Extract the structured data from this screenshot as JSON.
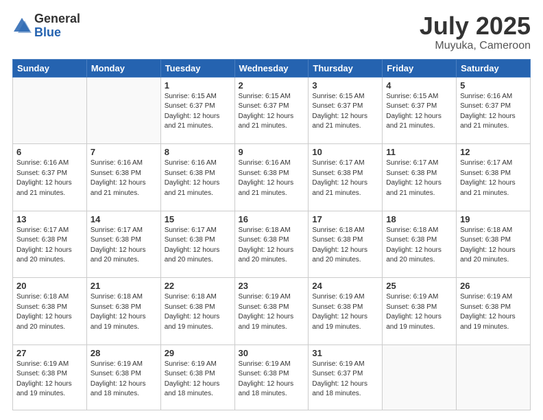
{
  "logo": {
    "general": "General",
    "blue": "Blue"
  },
  "header": {
    "title": "July 2025",
    "subtitle": "Muyuka, Cameroon"
  },
  "weekdays": [
    "Sunday",
    "Monday",
    "Tuesday",
    "Wednesday",
    "Thursday",
    "Friday",
    "Saturday"
  ],
  "weeks": [
    [
      {
        "day": null,
        "info": null
      },
      {
        "day": null,
        "info": null
      },
      {
        "day": "1",
        "info": "Sunrise: 6:15 AM\nSunset: 6:37 PM\nDaylight: 12 hours and 21 minutes."
      },
      {
        "day": "2",
        "info": "Sunrise: 6:15 AM\nSunset: 6:37 PM\nDaylight: 12 hours and 21 minutes."
      },
      {
        "day": "3",
        "info": "Sunrise: 6:15 AM\nSunset: 6:37 PM\nDaylight: 12 hours and 21 minutes."
      },
      {
        "day": "4",
        "info": "Sunrise: 6:15 AM\nSunset: 6:37 PM\nDaylight: 12 hours and 21 minutes."
      },
      {
        "day": "5",
        "info": "Sunrise: 6:16 AM\nSunset: 6:37 PM\nDaylight: 12 hours and 21 minutes."
      }
    ],
    [
      {
        "day": "6",
        "info": "Sunrise: 6:16 AM\nSunset: 6:37 PM\nDaylight: 12 hours and 21 minutes."
      },
      {
        "day": "7",
        "info": "Sunrise: 6:16 AM\nSunset: 6:38 PM\nDaylight: 12 hours and 21 minutes."
      },
      {
        "day": "8",
        "info": "Sunrise: 6:16 AM\nSunset: 6:38 PM\nDaylight: 12 hours and 21 minutes."
      },
      {
        "day": "9",
        "info": "Sunrise: 6:16 AM\nSunset: 6:38 PM\nDaylight: 12 hours and 21 minutes."
      },
      {
        "day": "10",
        "info": "Sunrise: 6:17 AM\nSunset: 6:38 PM\nDaylight: 12 hours and 21 minutes."
      },
      {
        "day": "11",
        "info": "Sunrise: 6:17 AM\nSunset: 6:38 PM\nDaylight: 12 hours and 21 minutes."
      },
      {
        "day": "12",
        "info": "Sunrise: 6:17 AM\nSunset: 6:38 PM\nDaylight: 12 hours and 21 minutes."
      }
    ],
    [
      {
        "day": "13",
        "info": "Sunrise: 6:17 AM\nSunset: 6:38 PM\nDaylight: 12 hours and 20 minutes."
      },
      {
        "day": "14",
        "info": "Sunrise: 6:17 AM\nSunset: 6:38 PM\nDaylight: 12 hours and 20 minutes."
      },
      {
        "day": "15",
        "info": "Sunrise: 6:17 AM\nSunset: 6:38 PM\nDaylight: 12 hours and 20 minutes."
      },
      {
        "day": "16",
        "info": "Sunrise: 6:18 AM\nSunset: 6:38 PM\nDaylight: 12 hours and 20 minutes."
      },
      {
        "day": "17",
        "info": "Sunrise: 6:18 AM\nSunset: 6:38 PM\nDaylight: 12 hours and 20 minutes."
      },
      {
        "day": "18",
        "info": "Sunrise: 6:18 AM\nSunset: 6:38 PM\nDaylight: 12 hours and 20 minutes."
      },
      {
        "day": "19",
        "info": "Sunrise: 6:18 AM\nSunset: 6:38 PM\nDaylight: 12 hours and 20 minutes."
      }
    ],
    [
      {
        "day": "20",
        "info": "Sunrise: 6:18 AM\nSunset: 6:38 PM\nDaylight: 12 hours and 20 minutes."
      },
      {
        "day": "21",
        "info": "Sunrise: 6:18 AM\nSunset: 6:38 PM\nDaylight: 12 hours and 19 minutes."
      },
      {
        "day": "22",
        "info": "Sunrise: 6:18 AM\nSunset: 6:38 PM\nDaylight: 12 hours and 19 minutes."
      },
      {
        "day": "23",
        "info": "Sunrise: 6:19 AM\nSunset: 6:38 PM\nDaylight: 12 hours and 19 minutes."
      },
      {
        "day": "24",
        "info": "Sunrise: 6:19 AM\nSunset: 6:38 PM\nDaylight: 12 hours and 19 minutes."
      },
      {
        "day": "25",
        "info": "Sunrise: 6:19 AM\nSunset: 6:38 PM\nDaylight: 12 hours and 19 minutes."
      },
      {
        "day": "26",
        "info": "Sunrise: 6:19 AM\nSunset: 6:38 PM\nDaylight: 12 hours and 19 minutes."
      }
    ],
    [
      {
        "day": "27",
        "info": "Sunrise: 6:19 AM\nSunset: 6:38 PM\nDaylight: 12 hours and 19 minutes."
      },
      {
        "day": "28",
        "info": "Sunrise: 6:19 AM\nSunset: 6:38 PM\nDaylight: 12 hours and 18 minutes."
      },
      {
        "day": "29",
        "info": "Sunrise: 6:19 AM\nSunset: 6:38 PM\nDaylight: 12 hours and 18 minutes."
      },
      {
        "day": "30",
        "info": "Sunrise: 6:19 AM\nSunset: 6:38 PM\nDaylight: 12 hours and 18 minutes."
      },
      {
        "day": "31",
        "info": "Sunrise: 6:19 AM\nSunset: 6:37 PM\nDaylight: 12 hours and 18 minutes."
      },
      {
        "day": null,
        "info": null
      },
      {
        "day": null,
        "info": null
      }
    ]
  ]
}
